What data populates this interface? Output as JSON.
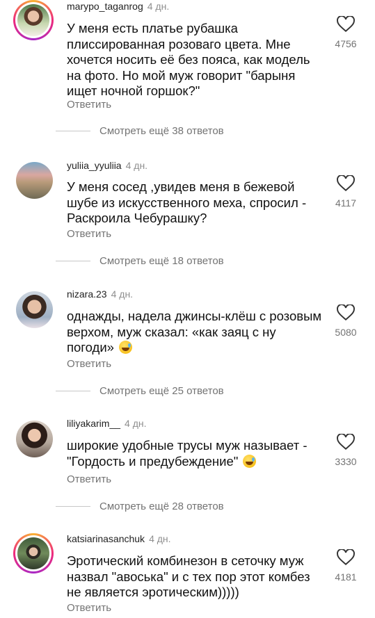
{
  "comments": [
    {
      "username": "marypo_taganrog",
      "time": "4 дн.",
      "text": "У меня есть платье рубашка плиссированная розоваго цвета. Мне хочется носить её без пояса, как модель на фото. Но мой муж говорит \"барыня ищет ночной горшок?\"",
      "likes": "4756",
      "reply": "Ответить",
      "more": "Смотреть ещё 38 ответов"
    },
    {
      "username": "yuliia_yyuliia",
      "time": "4 дн.",
      "text": "У меня сосед ,увидев меня в бежевой шубе из искусственного меха, спросил - Раскроила Чебурашку?",
      "likes": "4117",
      "reply": "Ответить",
      "more": "Смотреть ещё 18 ответов"
    },
    {
      "username": "nizara.23",
      "time": "4 дн.",
      "text": "однажды, надела джинсы-клёш с розовым верхом, муж сказал: «как заяц с ну погоди»",
      "likes": "5080",
      "reply": "Ответить",
      "more": "Смотреть ещё 25 ответов"
    },
    {
      "username": "liliyakarim__",
      "time": "4 дн.",
      "text": "широкие удобные трусы муж называет - \"Гордость и предубеждение\"",
      "likes": "3330",
      "reply": "Ответить",
      "more": "Смотреть ещё 28 ответов"
    },
    {
      "username": "katsiarinasanchuk",
      "time": "4 дн.",
      "text": "Эротический комбинезон в сеточку муж назвал \"авоська\" и с тех пор этот комбез не является эротическим)))))",
      "likes": "4181",
      "reply": "Ответить"
    }
  ]
}
